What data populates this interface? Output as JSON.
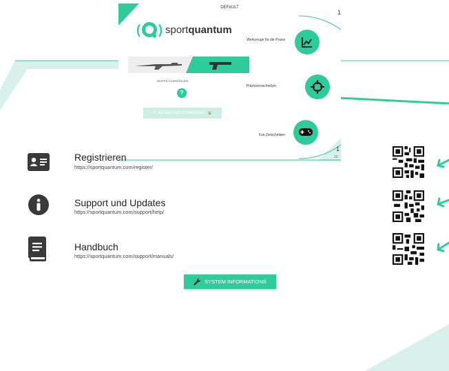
{
  "colors": {
    "accent": "#2ecc9a",
    "accent_light": "#cdeee2",
    "deco": "#d7f0ea",
    "text": "#222222"
  },
  "panel": {
    "title": "DEFAULT",
    "logo": {
      "prefix": "sport",
      "bold": "quantum"
    },
    "weapon_label": "WAFFE AUSWÄHLEN",
    "help": "?",
    "shutdown_label": "ANLAGE HERUNTERFAHREN",
    "menu": [
      {
        "label": "Werkzeuge für die Praxis",
        "icon": "chart-icon"
      },
      {
        "label": "Präzisionsschießen",
        "icon": "crosshair-icon"
      },
      {
        "label": "Fun Zielscheiben",
        "icon": "gamepad-icon"
      }
    ],
    "partial_right_top": "1",
    "partial_right_bottom": "1",
    "partial_right_bottom_small": "20"
  },
  "links": [
    {
      "title": "Registrieren",
      "url": "https://sportquantum.com/register/",
      "icon": "id-card-icon"
    },
    {
      "title": "Support und Updates",
      "url": "https://sportquantum.com/support/help/",
      "icon": "info-icon"
    },
    {
      "title": "Handbuch",
      "url": "https://sportquantum.com/support/manuals/",
      "icon": "book-icon"
    }
  ],
  "system_button": {
    "label": "SYSTEM INFORMATIONS",
    "icon": "wrench-icon"
  }
}
